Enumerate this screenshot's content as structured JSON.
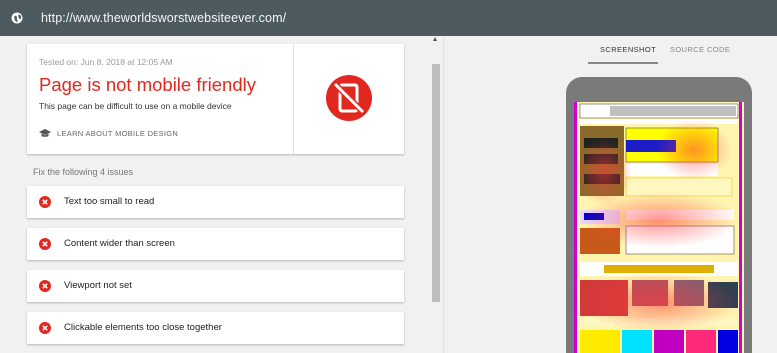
{
  "browser": {
    "url": "http://www.theworldsworstwebsiteever.com/",
    "icon": "globe-icon"
  },
  "result": {
    "tested_on": "Tested on: Jun 8, 2018 at 12:05 AM",
    "title": "Page is not mobile friendly",
    "subtitle": "This page can be difficult to use on a mobile device",
    "learn_link": "LEARN ABOUT MOBILE DESIGN",
    "status_icon": "not-mobile-friendly-icon"
  },
  "issues": {
    "heading": "Fix the following 4 issues",
    "items": [
      {
        "label": "Text too small to read"
      },
      {
        "label": "Content wider than screen"
      },
      {
        "label": "Viewport not set"
      },
      {
        "label": "Clickable elements too close together"
      }
    ]
  },
  "preview": {
    "tabs": [
      {
        "label": "SCREENSHOT",
        "active": true
      },
      {
        "label": "SOURCE CODE",
        "active": false
      }
    ]
  },
  "colors": {
    "topbar": "#4d5b60",
    "error_red": "#e0281f",
    "background": "#f1f1f1"
  }
}
